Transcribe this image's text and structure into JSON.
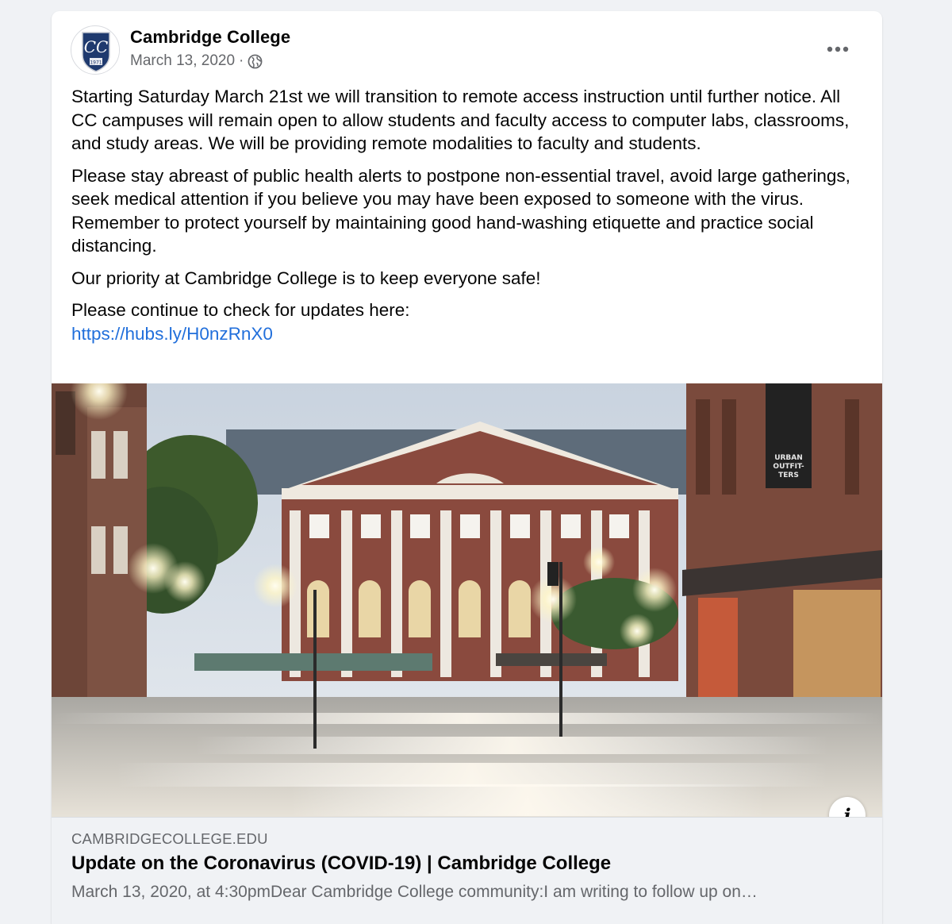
{
  "post": {
    "page_name": "Cambridge College",
    "date": "March 13, 2020",
    "separator": "·",
    "privacy_icon": "globe-icon",
    "more_icon": "more-options-icon",
    "avatar": {
      "monogram": "CC",
      "year": "1971",
      "colors": {
        "shield": "#1f3a6e",
        "text": "#ffffff"
      }
    },
    "paragraphs": [
      "Starting Saturday March 21st we will transition to remote access instruction until further notice. All CC campuses will remain open to allow students and faculty access to computer labs, classrooms, and study areas. We will be providing remote modalities to faculty and students.",
      "Please stay abreast of public health alerts to postpone non-essential travel, avoid large gatherings, seek medical attention if you believe you may have been exposed to someone with the virus.  Remember to protect yourself by maintaining good hand-washing etiquette and practice social distancing.",
      "Our priority at Cambridge College is to keep everyone safe!"
    ],
    "updates_text": "Please continue to check for updates here:",
    "updates_link": "https://hubs.ly/H0nzRnX0",
    "photo": {
      "sign_text": [
        "URBAN",
        "OUTFIT-",
        "TERS"
      ]
    },
    "info_icon_glyph": "i",
    "link_preview": {
      "domain": "CAMBRIDGECOLLEGE.EDU",
      "title": "Update on the Coronavirus (COVID-19) | Cambridge College",
      "description": "March 13, 2020, at 4:30pmDear Cambridge College community:I am writing to follow up on…"
    }
  },
  "colors": {
    "background": "#f0f2f5",
    "card": "#ffffff",
    "text_primary": "#050505",
    "text_secondary": "#65676b",
    "link": "#216fdb"
  }
}
